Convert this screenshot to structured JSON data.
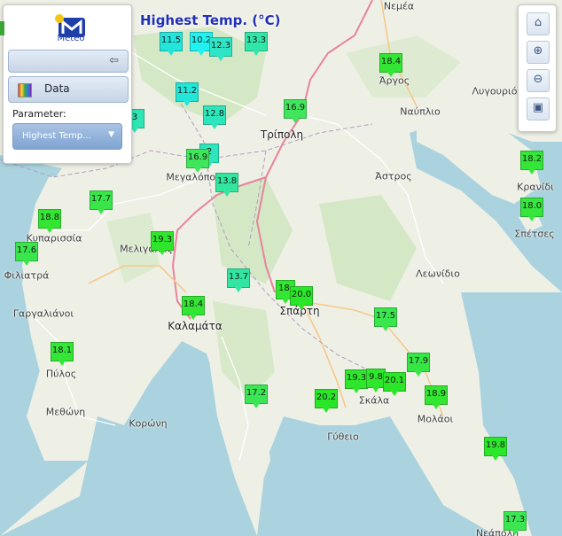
{
  "map": {
    "title": "Highest Temp. (°C)",
    "places": [
      {
        "name": "Νεμέα",
        "big": false
      },
      {
        "name": "Άργος",
        "big": false
      },
      {
        "name": "Λυγουριό",
        "big": false
      },
      {
        "name": "Ναύπλιο",
        "big": false
      },
      {
        "name": "Τρίπολη",
        "big": true
      },
      {
        "name": "Κρανίδι",
        "big": false
      },
      {
        "name": "Σπέτσες",
        "big": false
      },
      {
        "name": "Άστρος",
        "big": false
      },
      {
        "name": "Μεγαλόπολη",
        "big": false
      },
      {
        "name": "Κυπαρισσία",
        "big": false
      },
      {
        "name": "Μελιγαλάς",
        "big": false
      },
      {
        "name": "Φιλιατρά",
        "big": false
      },
      {
        "name": "Γαργαλιάνοι",
        "big": false
      },
      {
        "name": "Καλαμάτα",
        "big": true
      },
      {
        "name": "Σπάρτη",
        "big": true
      },
      {
        "name": "Λεωνίδιο",
        "big": false
      },
      {
        "name": "Πύλος",
        "big": false
      },
      {
        "name": "Μεθώνη",
        "big": false
      },
      {
        "name": "Κορώνη",
        "big": false
      },
      {
        "name": "Σκάλα",
        "big": false
      },
      {
        "name": "Μολάοι",
        "big": false
      },
      {
        "name": "Γύθειο",
        "big": false
      },
      {
        "name": "Νεάπολη",
        "big": false
      }
    ],
    "markers": [
      {
        "value": "11.5",
        "color": "#22e6dc"
      },
      {
        "value": "10.2",
        "color": "#1ff2f0"
      },
      {
        "value": "12.3",
        "color": "#2ee6c6"
      },
      {
        "value": "13.3",
        "color": "#30e6a8"
      },
      {
        "value": "11.2",
        "color": "#22e6d8"
      },
      {
        "value": "12.8",
        "color": "#2ee6bc"
      },
      {
        "value": "3",
        "color": "#2ee6b4"
      },
      {
        "value": "16.9",
        "color": "#3fe65c"
      },
      {
        "value": "2",
        "color": "#2ee6bc"
      },
      {
        "value": "16.9",
        "color": "#3fe65c"
      },
      {
        "value": "13.8",
        "color": "#32e6a0"
      },
      {
        "value": "18.4",
        "color": "#33e635"
      },
      {
        "value": "18.2",
        "color": "#33e638"
      },
      {
        "value": "18.0",
        "color": "#35e63c"
      },
      {
        "value": "17.7",
        "color": "#38e64a"
      },
      {
        "value": "18.8",
        "color": "#33e632"
      },
      {
        "value": "17.6",
        "color": "#39e64c"
      },
      {
        "value": "19.3",
        "color": "#2fe62c"
      },
      {
        "value": "13.7",
        "color": "#32e6a2"
      },
      {
        "value": "18.",
        "color": "#33e633"
      },
      {
        "value": "20.0",
        "color": "#2ae628"
      },
      {
        "value": "18.4",
        "color": "#33e635"
      },
      {
        "value": "17.5",
        "color": "#39e64e"
      },
      {
        "value": "18.1",
        "color": "#33e637"
      },
      {
        "value": "17.9",
        "color": "#36e644"
      },
      {
        "value": "19.3",
        "color": "#2fe62c"
      },
      {
        "value": "9.8",
        "color": "#2fe62d"
      },
      {
        "value": "20.1",
        "color": "#2ae627"
      },
      {
        "value": "18.9",
        "color": "#33e631"
      },
      {
        "value": "17.2",
        "color": "#3be655"
      },
      {
        "value": "20.2",
        "color": "#29e627"
      },
      {
        "value": "19.8",
        "color": "#2be629"
      },
      {
        "value": "17.3",
        "color": "#3be652"
      }
    ]
  },
  "panel": {
    "logo_text": "Meteo",
    "collapse_icon": "arrow-left-icon",
    "data_label": "Data",
    "parameter_label": "Parameter:",
    "parameter_value": "Highest Temp..."
  },
  "zoom": {
    "home_icon": "home-icon",
    "zoom_in_icon": "zoom-in-icon",
    "zoom_out_icon": "zoom-out-icon",
    "extent_icon": "zoom-extent-icon"
  }
}
